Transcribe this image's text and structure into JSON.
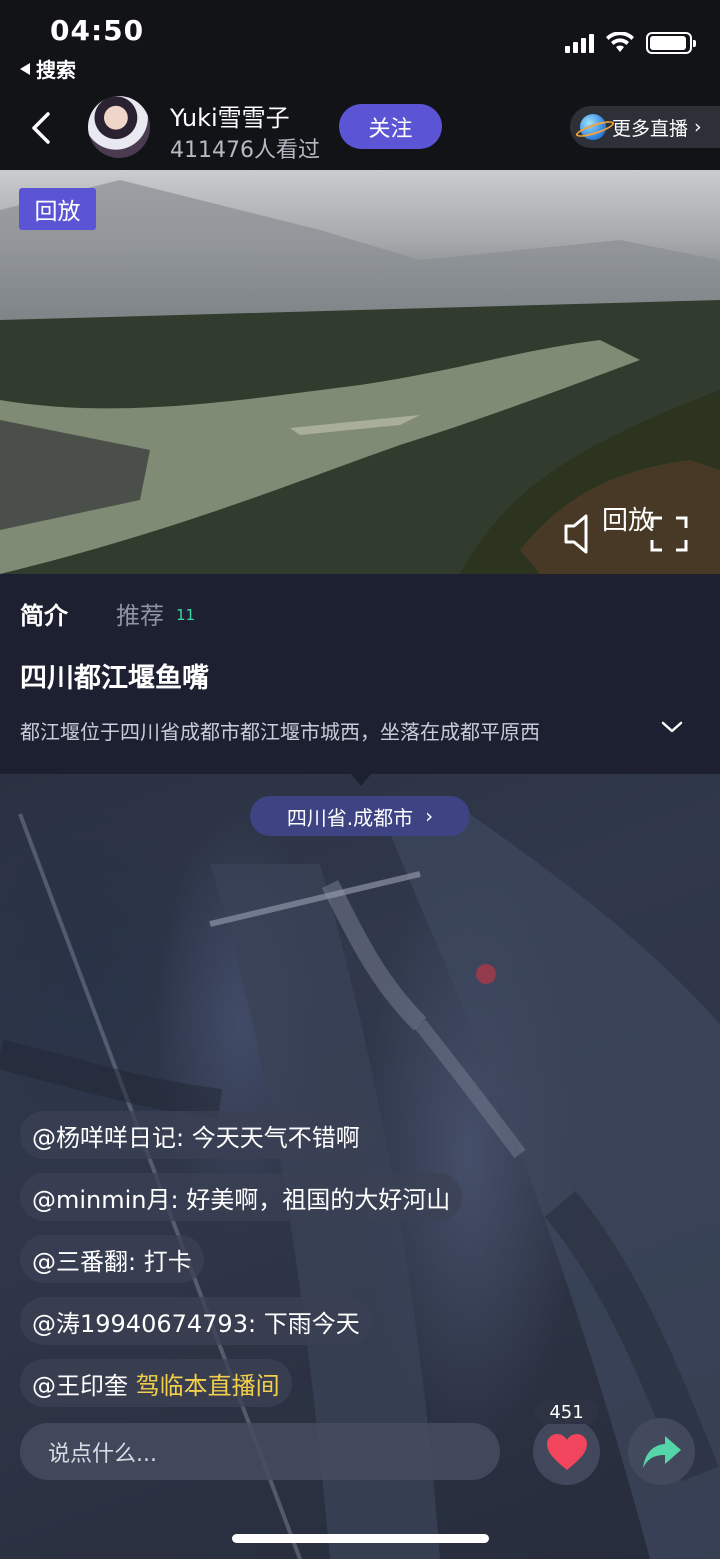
{
  "status_bar": {
    "time": "04:50",
    "back_app": "搜索",
    "battery_level": 0.95
  },
  "header": {
    "host_name": "Yuki雪雪子",
    "views": "411476人看过",
    "follow_label": "关注",
    "more_live_label": "更多直播"
  },
  "video": {
    "replay_badge": "回放",
    "overlay_text": "回放"
  },
  "info": {
    "tabs": [
      {
        "label": "简介",
        "active": true
      },
      {
        "label": "推荐",
        "count": "11",
        "active": false
      }
    ],
    "title": "四川都江堰鱼嘴",
    "description": "都江堰位于四川省成都市都江堰市城西，坐落在成都平原西"
  },
  "map": {
    "location_label": "四川省.成都市"
  },
  "comments": [
    {
      "user": "@杨咩咩日记:",
      "text": "今天天气不错啊",
      "highlight": false
    },
    {
      "user": "@minmin月:",
      "text": "好美啊，祖国的大好河山",
      "highlight": false
    },
    {
      "user": "@三番翻:",
      "text": "打卡",
      "highlight": false
    },
    {
      "user": "@涛19940674793:",
      "text": "下雨今天",
      "highlight": false
    },
    {
      "user": "@王印奎",
      "text": "驾临本直播间",
      "highlight": true
    }
  ],
  "footer": {
    "input_placeholder": "说点什么...",
    "like_count": "451"
  },
  "colors": {
    "accent": "#5b55d6",
    "highlight": "#f2d04b",
    "like": "#f0455d",
    "share": "#55d6a8"
  }
}
